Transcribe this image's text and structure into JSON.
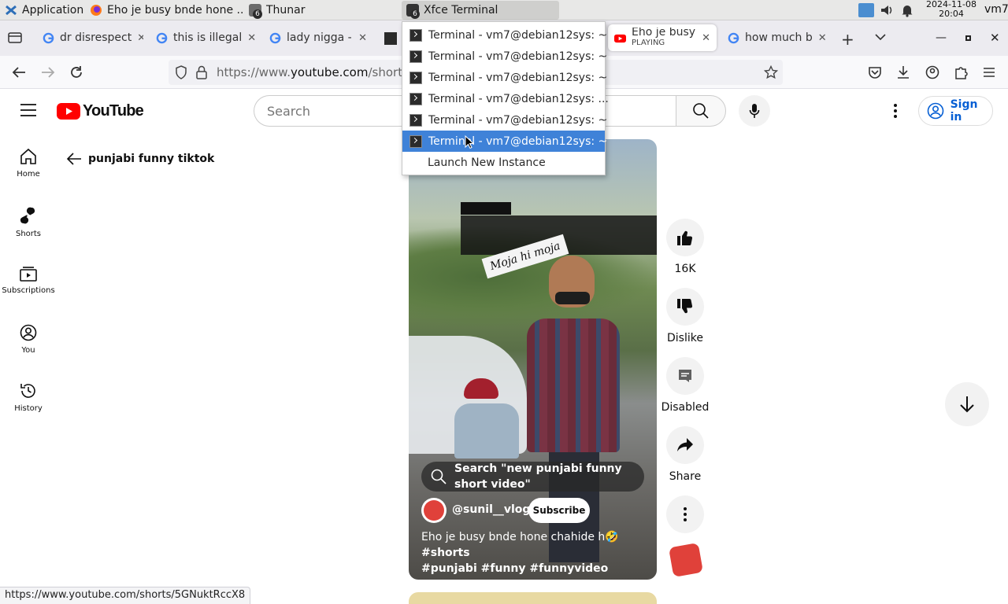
{
  "taskbar": {
    "apps_label": "Applications",
    "windows": [
      {
        "title": "Eho je busy bnde hone ..."
      },
      {
        "title": "Thunar",
        "count": "6"
      },
      {
        "title": "Xfce Terminal",
        "count": "6"
      }
    ],
    "clock_date": "2024-11-08",
    "clock_time": "20:04",
    "user": "vm7"
  },
  "browser": {
    "tabs": [
      {
        "title": "dr disrespect"
      },
      {
        "title": "this is illegal"
      },
      {
        "title": "lady nigga -"
      },
      {
        "title": "Eho je busy b",
        "sub": "PLAYING"
      },
      {
        "title": "how much b"
      }
    ],
    "url_prefix": "https://www.",
    "url_domain": "youtube.com",
    "url_path": "/shorts/5",
    "status_url": "https://www.youtube.com/shorts/5GNuktRccX8"
  },
  "terminal_menu": {
    "items": [
      "Terminal - vm7@debian12sys: ~",
      "Terminal - vm7@debian12sys: ~",
      "Terminal - vm7@debian12sys: ~",
      "Terminal - vm7@debian12sys: ...",
      "Terminal - vm7@debian12sys: ~",
      "Terminal - vm7@debian12sys: ~"
    ],
    "highlighted_index": 5,
    "launch_label": "Launch New Instance"
  },
  "youtube": {
    "logo_text": "YouTube",
    "search_placeholder": "Search",
    "sign_in": "Sign in",
    "sidebar": [
      {
        "label": "Home"
      },
      {
        "label": "Shorts"
      },
      {
        "label": "Subscriptions"
      },
      {
        "label": "You"
      },
      {
        "label": "History"
      }
    ],
    "back_title": "punjabi funny tiktok",
    "video": {
      "overlay_text": "Moja hi moja",
      "search_suggestion": "Search \"new punjabi funny short video\"",
      "channel": "@sunil__vlogz",
      "subscribe": "Subscribe",
      "caption_plain": "Eho je busy bnde hone chahide h🤣",
      "caption_tag1": "#shorts",
      "caption_tags": "#punjabi #funny #funnyvideo"
    },
    "actions": {
      "likes": "16K",
      "dislike": "Dislike",
      "comments": "Disabled",
      "share": "Share"
    }
  },
  "colors": {
    "youtube_red": "#ff0000",
    "menu_highlight": "#3f82d8",
    "sign_in_blue": "#065fd4"
  }
}
